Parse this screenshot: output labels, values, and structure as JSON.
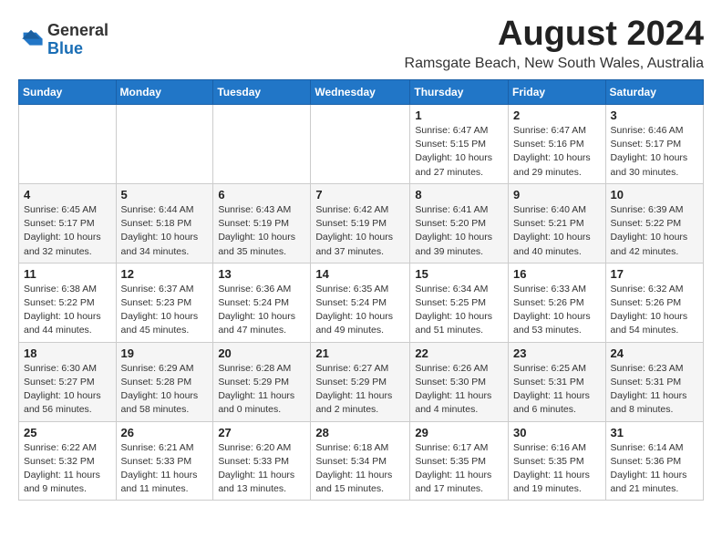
{
  "header": {
    "logo_general": "General",
    "logo_blue": "Blue",
    "month_year": "August 2024",
    "location": "Ramsgate Beach, New South Wales, Australia"
  },
  "days_of_week": [
    "Sunday",
    "Monday",
    "Tuesday",
    "Wednesday",
    "Thursday",
    "Friday",
    "Saturday"
  ],
  "weeks": [
    [
      {
        "day": "",
        "content": ""
      },
      {
        "day": "",
        "content": ""
      },
      {
        "day": "",
        "content": ""
      },
      {
        "day": "",
        "content": ""
      },
      {
        "day": "1",
        "content": "Sunrise: 6:47 AM\nSunset: 5:15 PM\nDaylight: 10 hours\nand 27 minutes."
      },
      {
        "day": "2",
        "content": "Sunrise: 6:47 AM\nSunset: 5:16 PM\nDaylight: 10 hours\nand 29 minutes."
      },
      {
        "day": "3",
        "content": "Sunrise: 6:46 AM\nSunset: 5:17 PM\nDaylight: 10 hours\nand 30 minutes."
      }
    ],
    [
      {
        "day": "4",
        "content": "Sunrise: 6:45 AM\nSunset: 5:17 PM\nDaylight: 10 hours\nand 32 minutes."
      },
      {
        "day": "5",
        "content": "Sunrise: 6:44 AM\nSunset: 5:18 PM\nDaylight: 10 hours\nand 34 minutes."
      },
      {
        "day": "6",
        "content": "Sunrise: 6:43 AM\nSunset: 5:19 PM\nDaylight: 10 hours\nand 35 minutes."
      },
      {
        "day": "7",
        "content": "Sunrise: 6:42 AM\nSunset: 5:19 PM\nDaylight: 10 hours\nand 37 minutes."
      },
      {
        "day": "8",
        "content": "Sunrise: 6:41 AM\nSunset: 5:20 PM\nDaylight: 10 hours\nand 39 minutes."
      },
      {
        "day": "9",
        "content": "Sunrise: 6:40 AM\nSunset: 5:21 PM\nDaylight: 10 hours\nand 40 minutes."
      },
      {
        "day": "10",
        "content": "Sunrise: 6:39 AM\nSunset: 5:22 PM\nDaylight: 10 hours\nand 42 minutes."
      }
    ],
    [
      {
        "day": "11",
        "content": "Sunrise: 6:38 AM\nSunset: 5:22 PM\nDaylight: 10 hours\nand 44 minutes."
      },
      {
        "day": "12",
        "content": "Sunrise: 6:37 AM\nSunset: 5:23 PM\nDaylight: 10 hours\nand 45 minutes."
      },
      {
        "day": "13",
        "content": "Sunrise: 6:36 AM\nSunset: 5:24 PM\nDaylight: 10 hours\nand 47 minutes."
      },
      {
        "day": "14",
        "content": "Sunrise: 6:35 AM\nSunset: 5:24 PM\nDaylight: 10 hours\nand 49 minutes."
      },
      {
        "day": "15",
        "content": "Sunrise: 6:34 AM\nSunset: 5:25 PM\nDaylight: 10 hours\nand 51 minutes."
      },
      {
        "day": "16",
        "content": "Sunrise: 6:33 AM\nSunset: 5:26 PM\nDaylight: 10 hours\nand 53 minutes."
      },
      {
        "day": "17",
        "content": "Sunrise: 6:32 AM\nSunset: 5:26 PM\nDaylight: 10 hours\nand 54 minutes."
      }
    ],
    [
      {
        "day": "18",
        "content": "Sunrise: 6:30 AM\nSunset: 5:27 PM\nDaylight: 10 hours\nand 56 minutes."
      },
      {
        "day": "19",
        "content": "Sunrise: 6:29 AM\nSunset: 5:28 PM\nDaylight: 10 hours\nand 58 minutes."
      },
      {
        "day": "20",
        "content": "Sunrise: 6:28 AM\nSunset: 5:29 PM\nDaylight: 11 hours\nand 0 minutes."
      },
      {
        "day": "21",
        "content": "Sunrise: 6:27 AM\nSunset: 5:29 PM\nDaylight: 11 hours\nand 2 minutes."
      },
      {
        "day": "22",
        "content": "Sunrise: 6:26 AM\nSunset: 5:30 PM\nDaylight: 11 hours\nand 4 minutes."
      },
      {
        "day": "23",
        "content": "Sunrise: 6:25 AM\nSunset: 5:31 PM\nDaylight: 11 hours\nand 6 minutes."
      },
      {
        "day": "24",
        "content": "Sunrise: 6:23 AM\nSunset: 5:31 PM\nDaylight: 11 hours\nand 8 minutes."
      }
    ],
    [
      {
        "day": "25",
        "content": "Sunrise: 6:22 AM\nSunset: 5:32 PM\nDaylight: 11 hours\nand 9 minutes."
      },
      {
        "day": "26",
        "content": "Sunrise: 6:21 AM\nSunset: 5:33 PM\nDaylight: 11 hours\nand 11 minutes."
      },
      {
        "day": "27",
        "content": "Sunrise: 6:20 AM\nSunset: 5:33 PM\nDaylight: 11 hours\nand 13 minutes."
      },
      {
        "day": "28",
        "content": "Sunrise: 6:18 AM\nSunset: 5:34 PM\nDaylight: 11 hours\nand 15 minutes."
      },
      {
        "day": "29",
        "content": "Sunrise: 6:17 AM\nSunset: 5:35 PM\nDaylight: 11 hours\nand 17 minutes."
      },
      {
        "day": "30",
        "content": "Sunrise: 6:16 AM\nSunset: 5:35 PM\nDaylight: 11 hours\nand 19 minutes."
      },
      {
        "day": "31",
        "content": "Sunrise: 6:14 AM\nSunset: 5:36 PM\nDaylight: 11 hours\nand 21 minutes."
      }
    ]
  ]
}
